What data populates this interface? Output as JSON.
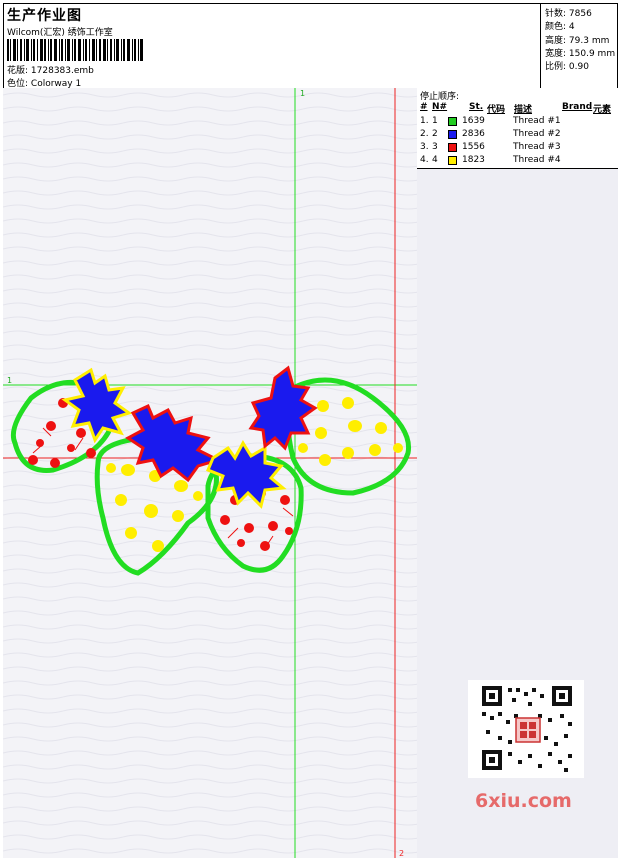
{
  "header": {
    "title": "生产作业图",
    "company": "Wilcom(汇宏) 绣饰工作室",
    "file_label": "花版:",
    "file_value": "1728383.emb",
    "color_label": "色位:",
    "color_value": "Colorway 1"
  },
  "stats": {
    "stitches_label": "针数:",
    "stitches_value": "7856",
    "colors_label": "颜色:",
    "colors_value": "4",
    "height_label": "高度:",
    "height_value": "79.3 mm",
    "width_label": "宽度:",
    "width_value": "150.9 mm",
    "scale_label": "比例:",
    "scale_value": "0.90"
  },
  "guides": {
    "v1_label": "1",
    "h1_label": "1",
    "v2_label": "2"
  },
  "stop_sequence": {
    "title": "停止顺序:",
    "columns": [
      "#",
      "N#",
      "St.",
      "代码",
      "描述",
      "Brand",
      "元素"
    ],
    "rows": [
      {
        "idx": "1.",
        "n": "1",
        "code": "1639",
        "desc": "Thread #1",
        "color": "#22cc22"
      },
      {
        "idx": "2.",
        "n": "2",
        "code": "2836",
        "desc": "Thread #2",
        "color": "#1a1aee"
      },
      {
        "idx": "3.",
        "n": "3",
        "code": "1556",
        "desc": "Thread #3",
        "color": "#ee1111"
      },
      {
        "idx": "4.",
        "n": "4",
        "code": "1823",
        "desc": "Thread #4",
        "color": "#ffee00"
      }
    ]
  },
  "watermark": {
    "brand": "6xiu.com"
  }
}
